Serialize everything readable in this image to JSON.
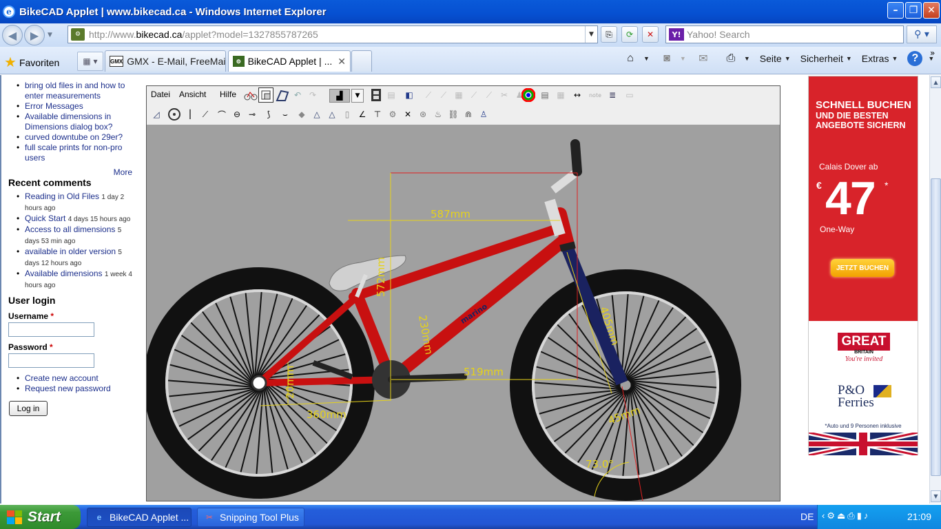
{
  "window": {
    "title": "BikeCAD Applet | www.bikecad.ca - Windows Internet Explorer"
  },
  "address": {
    "url_prefix": "http://www.",
    "url_host": "bikecad.ca",
    "url_suffix": "/applet?model=1327855787265"
  },
  "search": {
    "placeholder": "Yahoo! Search"
  },
  "favorites": {
    "label": "Favoriten"
  },
  "tabs": [
    {
      "label": "GMX - E-Mail, FreeMail...",
      "icon": "GMX"
    },
    {
      "label": "BikeCAD Applet | ..."
    }
  ],
  "commands": {
    "page": "Seite",
    "security": "Sicherheit",
    "extras": "Extras"
  },
  "sidebar": {
    "forum_links": [
      "bring old files in and how to enter measurements",
      "Error Messages",
      "Available dimensions in Dimensions dialog box?",
      "curved downtube on 29er?",
      "full scale prints for non-pro users"
    ],
    "more": "More",
    "recent_title": "Recent comments",
    "comments": [
      {
        "title": "Reading in Old Files",
        "meta": "1 day 2 hours ago"
      },
      {
        "title": "Quick Start",
        "meta": "4 days 15 hours ago"
      },
      {
        "title": "Access to all dimensions",
        "meta": "5 days 53 min ago"
      },
      {
        "title": "available in older version",
        "meta": "5 days 12 hours ago"
      },
      {
        "title": "Available dimensions",
        "meta": "1 week 4 hours ago"
      }
    ],
    "login_title": "User login",
    "username_label": "Username",
    "password_label": "Password",
    "required": "*",
    "account_links": [
      "Create new account",
      "Request new password"
    ],
    "login_button": "Log in"
  },
  "applet": {
    "menu": [
      "Datei",
      "Ansicht",
      "Hilfe"
    ],
    "dimensions": {
      "top_tube": "587mm",
      "seat_tube": "572mm",
      "standover": "230mm",
      "bb_drop": "20mm",
      "chainstay": "360mm",
      "front_center": "519mm",
      "fork": "405mm",
      "rake": "45mm",
      "head_angle": "73.0°"
    },
    "downtube_text": "marino",
    "colors": {
      "frame": "#c81010",
      "fork": "#1a2260",
      "dimension": "#e6d21a",
      "background": "#a0a0a0"
    }
  },
  "ad": {
    "headline": "SCHNELL BUCHEN",
    "subline": "UND DIE BESTEN ANGEBOTE SICHERN",
    "route": "Calais Dover ab",
    "currency": "€",
    "price": "47",
    "asterisk": "*",
    "oneway": "One-Way",
    "cta": "JETZT BUCHEN",
    "great": "GREAT",
    "britain": "BRITAIN",
    "invited": "You're invited",
    "brand_line1": "P&O",
    "brand_line2": "Ferries",
    "footnote": "*Auto und 9 Personen inklusive"
  },
  "taskbar": {
    "start": "Start",
    "tasks": [
      "BikeCAD Applet ...",
      "Snipping Tool Plus"
    ],
    "language": "DE",
    "clock": "21:09"
  }
}
